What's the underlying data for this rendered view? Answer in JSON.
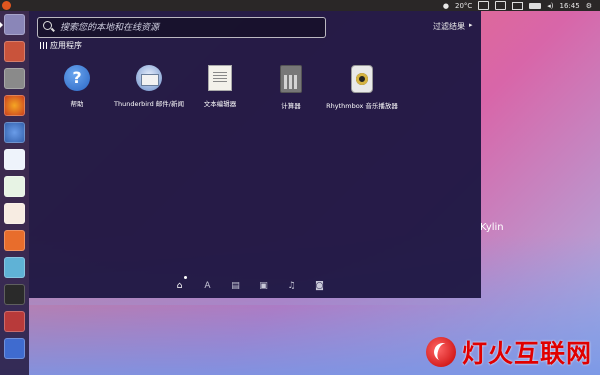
{
  "topbar": {
    "weather": "20°C",
    "clock": "16:45",
    "indicator_icons": [
      "user-icon",
      "keyboard-icon",
      "network-icon",
      "mail-icon",
      "battery-icon",
      "volume-icon",
      "gear-icon"
    ]
  },
  "dash": {
    "search_placeholder": "搜索您的本地和在线资源",
    "filter_label": "过滤结果",
    "section_title": "应用程序",
    "apps": [
      {
        "label": "帮助",
        "icon": "help-icon"
      },
      {
        "label": "Thunderbird 邮件/新闻",
        "icon": "thunderbird-icon"
      },
      {
        "label": "文本编辑器",
        "icon": "text-editor-icon"
      },
      {
        "label": "计算器",
        "icon": "calculator-icon"
      },
      {
        "label": "Rhythmbox 音乐播放器",
        "icon": "rhythmbox-icon"
      }
    ],
    "lenses": [
      {
        "name": "home-lens-icon",
        "glyph": "⌂"
      },
      {
        "name": "applications-lens-icon",
        "glyph": "A"
      },
      {
        "name": "files-lens-icon",
        "glyph": "▤"
      },
      {
        "name": "video-lens-icon",
        "glyph": "▣"
      },
      {
        "name": "music-lens-icon",
        "glyph": "♫"
      },
      {
        "name": "photo-lens-icon",
        "glyph": "◙"
      }
    ]
  },
  "launcher": {
    "items": [
      "dash-home",
      "files",
      "file-manager",
      "firefox",
      "chromium",
      "libreoffice-writer",
      "libreoffice-calc",
      "libreoffice-impress",
      "software-center",
      "image-viewer",
      "terminal",
      "system-settings",
      "ubuntu-kylin"
    ]
  },
  "desktop": {
    "brand_text": "Kylin",
    "watermark": "灯火互联网"
  },
  "colors": {
    "dash_bg": "#1e1844",
    "accent": "#e0561f",
    "watermark": "#e00000"
  }
}
